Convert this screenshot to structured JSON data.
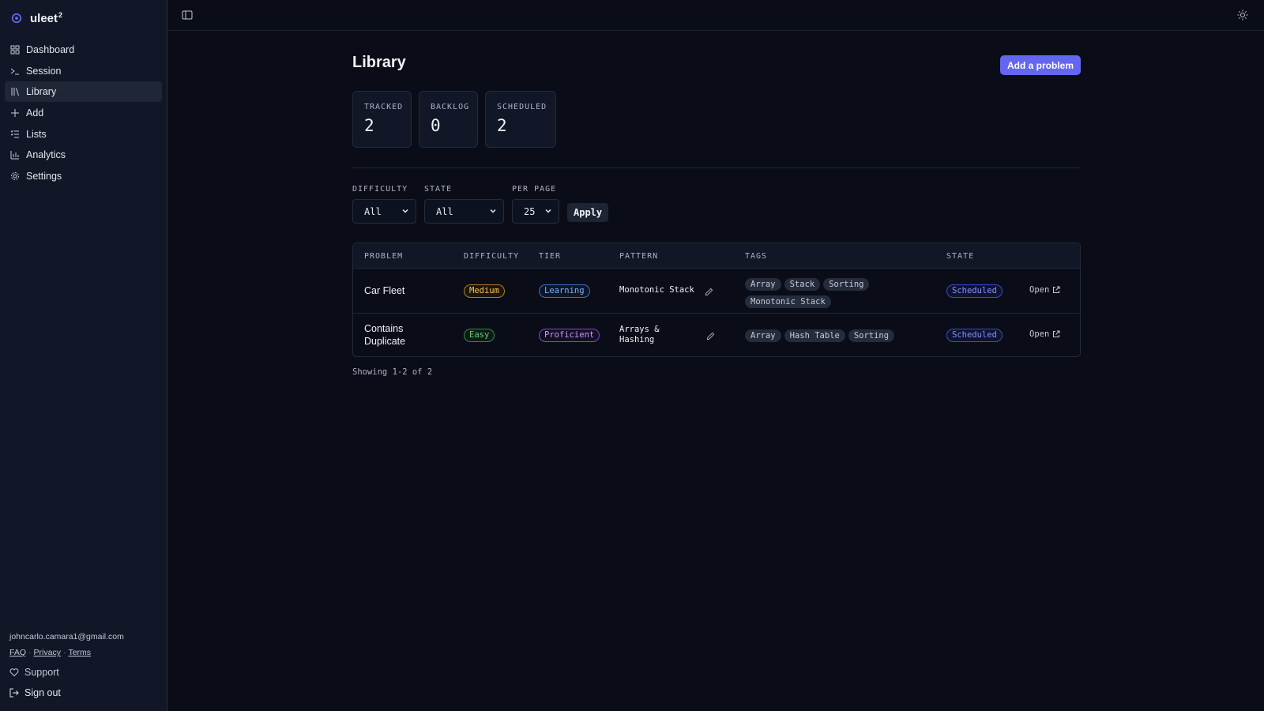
{
  "app": {
    "name": "uleet",
    "superscript": "2"
  },
  "sidebar": {
    "items": [
      {
        "label": "Dashboard",
        "icon": "dashboard-icon"
      },
      {
        "label": "Session",
        "icon": "terminal-icon"
      },
      {
        "label": "Library",
        "icon": "library-icon",
        "active": true
      },
      {
        "label": "Add",
        "icon": "plus-icon"
      },
      {
        "label": "Lists",
        "icon": "list-icon"
      },
      {
        "label": "Analytics",
        "icon": "bar-chart-icon"
      },
      {
        "label": "Settings",
        "icon": "gear-icon"
      }
    ],
    "email": "johncarlo.camara1@gmail.com",
    "footer_links": [
      "FAQ",
      "Privacy",
      "Terms"
    ],
    "support": "Support",
    "sign_out": "Sign out"
  },
  "page": {
    "title": "Library",
    "add_button": "Add a problem"
  },
  "stats": [
    {
      "label": "TRACKED",
      "value": "2"
    },
    {
      "label": "BACKLOG",
      "value": "0"
    },
    {
      "label": "SCHEDULED",
      "value": "2"
    }
  ],
  "filters": {
    "difficulty": {
      "label": "DIFFICULTY",
      "value": "All"
    },
    "state": {
      "label": "STATE",
      "value": "All"
    },
    "per_page": {
      "label": "PER PAGE",
      "value": "25"
    },
    "apply": "Apply"
  },
  "table": {
    "headers": [
      "PROBLEM",
      "DIFFICULTY",
      "TIER",
      "PATTERN",
      "TAGS",
      "STATE"
    ],
    "rows": [
      {
        "problem": "Car Fleet",
        "difficulty": "Medium",
        "tier": "Learning",
        "pattern": "Monotonic Stack",
        "tags": [
          "Array",
          "Stack",
          "Sorting",
          "Monotonic Stack"
        ],
        "state": "Scheduled",
        "action": "Open"
      },
      {
        "problem": "Contains Duplicate",
        "difficulty": "Easy",
        "tier": "Proficient",
        "pattern": "Arrays & Hashing",
        "tags": [
          "Array",
          "Hash Table",
          "Sorting"
        ],
        "state": "Scheduled",
        "action": "Open"
      }
    ]
  },
  "pagination": {
    "summary": "Showing 1-2 of 2"
  },
  "colors": {
    "accent": "#6366f1",
    "background": "#0a0d17",
    "sidebar": "#111726"
  }
}
